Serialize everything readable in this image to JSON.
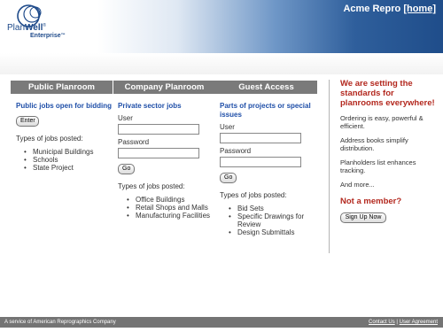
{
  "header": {
    "logo_text_plan": "Plan",
    "logo_text_well": "Well",
    "logo_tm": "®",
    "logo_sub": "Enterprise",
    "logo_sub_tm": "™",
    "site_name": "Acme Repro",
    "home_link": "[home]"
  },
  "columns": [
    {
      "heading": "Public Planroom",
      "title": "Public jobs open for bidding",
      "button": "Enter",
      "jobs_label": "Types of jobs posted:",
      "jobs": [
        "Municipal Buildings",
        "Schools",
        "State Project"
      ]
    },
    {
      "heading": "Company Planroom",
      "title": "Private sector jobs",
      "user_label": "User",
      "password_label": "Password",
      "button": "Go",
      "jobs_label": "Types of jobs posted:",
      "jobs": [
        "Office Buildings",
        "Retail Shops and Malls",
        "Manufacturing Facilities"
      ]
    },
    {
      "heading": "Guest Access",
      "title": "Parts of projects or special issues",
      "user_label": "User",
      "password_label": "Password",
      "button": "Go",
      "jobs_label": "Types of jobs posted:",
      "jobs": [
        "Bid Sets",
        "Specific Drawings for Review",
        "Design Submittals"
      ]
    }
  ],
  "side": {
    "title": "We are setting the standards for planrooms everywhere!",
    "points": [
      "Ordering is easy, powerful & efficient.",
      "Address books simplify distribution.",
      "Planholders list enhances tracking.",
      "And more..."
    ],
    "member_title": "Not a member?",
    "signup_button": "Sign Up Now"
  },
  "footer": {
    "service_text": "A service of American Reprographics Company",
    "contact_link": "Contact Us",
    "separator": "|",
    "agreement_link": "User Agreement"
  },
  "colors": {
    "column_header": "#7a7a7a",
    "link_blue": "#1f4fa8",
    "accent_red": "#b3281e",
    "header_blue": "#1f4d8a"
  }
}
